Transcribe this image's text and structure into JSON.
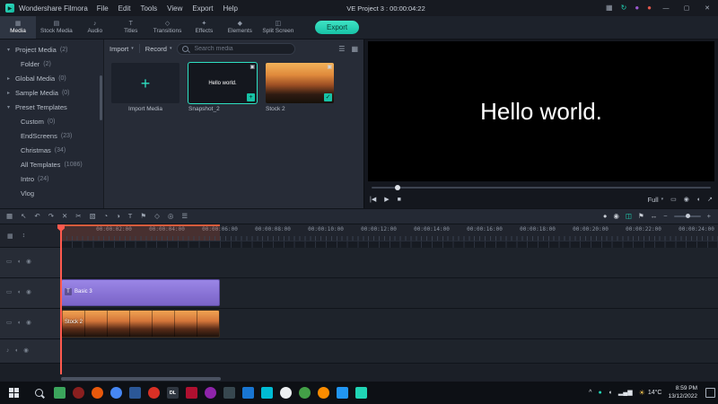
{
  "accent": "#20d5b5",
  "titlebar": {
    "app_name": "Wondershare Filmora",
    "menus": [
      {
        "label": "File"
      },
      {
        "label": "Edit"
      },
      {
        "label": "Tools"
      },
      {
        "label": "View"
      },
      {
        "label": "Export"
      },
      {
        "label": "Help"
      }
    ],
    "project_title": "VE Project 3 : 00:00:04:22",
    "right_icons": [
      {
        "name": "layout-switch-icon",
        "glyph": "▦",
        "color": "#9aa3b0"
      },
      {
        "name": "sync-icon",
        "glyph": "↻",
        "color": "#20d5b5"
      },
      {
        "name": "avatar",
        "glyph": "●",
        "color": "#9b59d0"
      },
      {
        "name": "notifications-icon",
        "glyph": "●",
        "color": "#e2574c"
      }
    ],
    "window_controls": {
      "minimize": "—",
      "maximize": "▢",
      "close": "✕"
    }
  },
  "ribbon": {
    "tabs": [
      {
        "name": "tab-media",
        "label": "Media",
        "glyph": "▦",
        "active": true
      },
      {
        "name": "tab-stock-media",
        "label": "Stock Media",
        "glyph": "▤"
      },
      {
        "name": "tab-audio",
        "label": "Audio",
        "glyph": "♪"
      },
      {
        "name": "tab-titles",
        "label": "Titles",
        "glyph": "T"
      },
      {
        "name": "tab-transitions",
        "label": "Transitions",
        "glyph": "◇"
      },
      {
        "name": "tab-effects",
        "label": "Effects",
        "glyph": "✦"
      },
      {
        "name": "tab-elements",
        "label": "Elements",
        "glyph": "◆"
      },
      {
        "name": "tab-split-screen",
        "label": "Split Screen",
        "glyph": "◫"
      }
    ],
    "export_label": "Export"
  },
  "sidebar": {
    "items": [
      {
        "label": "Project Media",
        "count": "(2)",
        "arrow": "▾",
        "level": 0
      },
      {
        "label": "Folder",
        "count": "(2)",
        "arrow": "",
        "level": 1,
        "selected": true
      },
      {
        "label": "Global Media",
        "count": "(0)",
        "arrow": "▸",
        "level": 0
      },
      {
        "label": "Sample Media",
        "count": "(0)",
        "arrow": "▸",
        "level": 0
      },
      {
        "label": "Preset Templates",
        "count": "",
        "arrow": "▾",
        "level": 0
      },
      {
        "label": "Custom",
        "count": "(0)",
        "arrow": "",
        "level": 1
      },
      {
        "label": "EndScreens",
        "count": "(23)",
        "arrow": "",
        "level": 1
      },
      {
        "label": "Christmas",
        "count": "(34)",
        "arrow": "",
        "level": 1
      },
      {
        "label": "All Templates",
        "count": "(1086)",
        "arrow": "",
        "level": 1
      },
      {
        "label": "Intro",
        "count": "(24)",
        "arrow": "",
        "level": 1
      },
      {
        "label": "Vlog",
        "count": "",
        "arrow": "",
        "level": 1
      }
    ]
  },
  "media_panel": {
    "import_label": "Import",
    "record_label": "Record",
    "search_placeholder": "Search media",
    "caret": "▾",
    "right_icons": [
      {
        "name": "filter-icon",
        "glyph": "☰"
      },
      {
        "name": "grid-view-icon",
        "glyph": "▦"
      }
    ],
    "badges": {
      "plus": "+",
      "add": "+",
      "check": "✓",
      "type": "▣"
    },
    "tiles": [
      {
        "label": "Import Media"
      },
      {
        "label": "Snapshot_2",
        "thumb_text": "Hello world."
      },
      {
        "label": "Stock 2"
      }
    ]
  },
  "preview": {
    "overlay_text": "Hello world.",
    "transport": [
      {
        "name": "previous-frame-icon",
        "glyph": "|◀"
      },
      {
        "name": "play-icon",
        "glyph": "▶"
      },
      {
        "name": "stop-icon",
        "glyph": "■"
      }
    ],
    "quality_label": "Full",
    "caret": "▾",
    "right_icons": [
      {
        "name": "fit-screen-icon",
        "glyph": "▭"
      },
      {
        "name": "snapshot-camera-icon",
        "glyph": "◉"
      },
      {
        "name": "volume-icon",
        "glyph": "◖"
      },
      {
        "name": "fullscreen-icon",
        "glyph": "↗"
      }
    ]
  },
  "timeline_toolbar": {
    "left_tools": [
      {
        "name": "media-browser-icon",
        "glyph": "▦"
      },
      {
        "name": "pointer-icon",
        "glyph": "↖"
      },
      {
        "name": "undo-icon",
        "glyph": "↶"
      },
      {
        "name": "redo-icon",
        "glyph": "↷"
      },
      {
        "name": "delete-icon",
        "glyph": "✕"
      },
      {
        "name": "split-icon",
        "glyph": "✂"
      },
      {
        "name": "crop-icon",
        "glyph": "▧"
      },
      {
        "name": "speed-icon",
        "glyph": "◔"
      },
      {
        "name": "color-correction-icon",
        "glyph": "◑"
      },
      {
        "name": "add-text-icon",
        "glyph": "T"
      },
      {
        "name": "marker-icon",
        "glyph": "⚑"
      },
      {
        "name": "keyframe-icon",
        "glyph": "◇"
      },
      {
        "name": "motion-track-icon",
        "glyph": "◎"
      },
      {
        "name": "audio-mixer-icon",
        "glyph": "☰"
      }
    ],
    "right_tools": [
      {
        "name": "voiceover-mic-icon",
        "glyph": "●",
        "color": "#c9ced6"
      },
      {
        "name": "record-screen-icon",
        "glyph": "◉",
        "color": "#c9ced6"
      },
      {
        "name": "auto-ripple-icon",
        "glyph": "◫",
        "color": "#20d5b5"
      },
      {
        "name": "marker-flag-icon",
        "glyph": "⚑",
        "color": "#c9ced6"
      },
      {
        "name": "zoom-fit-icon",
        "glyph": "↔",
        "color": "#c9ced6"
      }
    ],
    "zoom_out": "−",
    "zoom_in": "+"
  },
  "timeline": {
    "corner_icons": [
      {
        "name": "manage-tracks-icon",
        "glyph": "▦"
      },
      {
        "name": "adjust-track-height-icon",
        "glyph": "↕"
      }
    ],
    "ruler_labels": [
      {
        "t": "00:00:02:00"
      },
      {
        "t": "00:00:04:00"
      },
      {
        "t": "00:00:06:00"
      },
      {
        "t": "00:00:08:00"
      },
      {
        "t": "00:00:10:00"
      },
      {
        "t": "00:00:12:00"
      },
      {
        "t": "00:00:14:00"
      },
      {
        "t": "00:00:16:00"
      },
      {
        "t": "00:00:18:00"
      },
      {
        "t": "00:00:20:00"
      },
      {
        "t": "00:00:22:00"
      },
      {
        "t": "00:00:24:00"
      }
    ],
    "tracks": [
      {
        "icons": [
          "▭",
          "◖",
          "◉"
        ]
      },
      {
        "icons": [
          "▭",
          "◖",
          "◉"
        ]
      },
      {
        "icons": [
          "▭",
          "◖",
          "◉"
        ]
      },
      {
        "icons": [
          "♪",
          "◖",
          "◉"
        ]
      }
    ],
    "clips": {
      "title": {
        "label": "Basic 3",
        "badge": "T"
      },
      "video": {
        "label": "Stock 2"
      }
    }
  },
  "taskbar": {
    "apps": [
      {
        "name": "taskbar-app-1",
        "color": "#3ba55c"
      },
      {
        "name": "taskbar-app-2",
        "color": "#8a1f1f",
        "round": true
      },
      {
        "name": "taskbar-app-3",
        "color": "#e8590c",
        "round": true
      },
      {
        "name": "taskbar-app-chrome",
        "color": "#4687f4",
        "round": true
      },
      {
        "name": "taskbar-app-5",
        "color": "#2b5797"
      },
      {
        "name": "taskbar-app-6",
        "color": "#d93025",
        "round": true
      },
      {
        "name": "taskbar-app-7",
        "color": "#2f3640",
        "letter": "DL"
      },
      {
        "name": "taskbar-app-8",
        "color": "#b01030"
      },
      {
        "name": "taskbar-app-9",
        "color": "#8e24aa",
        "round": true
      },
      {
        "name": "taskbar-app-10",
        "color": "#37474f"
      },
      {
        "name": "taskbar-app-11",
        "color": "#1976d2"
      },
      {
        "name": "taskbar-app-12",
        "color": "#00bcd4"
      },
      {
        "name": "taskbar-app-13",
        "color": "#eceff1",
        "round": true
      },
      {
        "name": "taskbar-app-14",
        "color": "#43a047",
        "round": true
      },
      {
        "name": "taskbar-app-15",
        "color": "#fb8c00",
        "round": true
      },
      {
        "name": "taskbar-app-16",
        "color": "#2196f3"
      },
      {
        "name": "taskbar-app-filmora",
        "color": "#20d5b5",
        "active": true
      }
    ],
    "tray_icons": [
      {
        "name": "tray-chevron-up-icon",
        "glyph": "^",
        "color": "#dfe3e9"
      },
      {
        "name": "tray-teal-app-icon",
        "glyph": "●",
        "color": "#20d5b5"
      },
      {
        "name": "tray-volume-icon",
        "glyph": "◖",
        "color": "#dfe3e9"
      },
      {
        "name": "tray-network-icon",
        "glyph": "▂▄▆",
        "color": "#dfe3e9"
      }
    ],
    "weather": {
      "icon": "☀",
      "temp": "14°C"
    },
    "clock": {
      "time": "8:59 PM",
      "date": "13/12/2022"
    }
  }
}
